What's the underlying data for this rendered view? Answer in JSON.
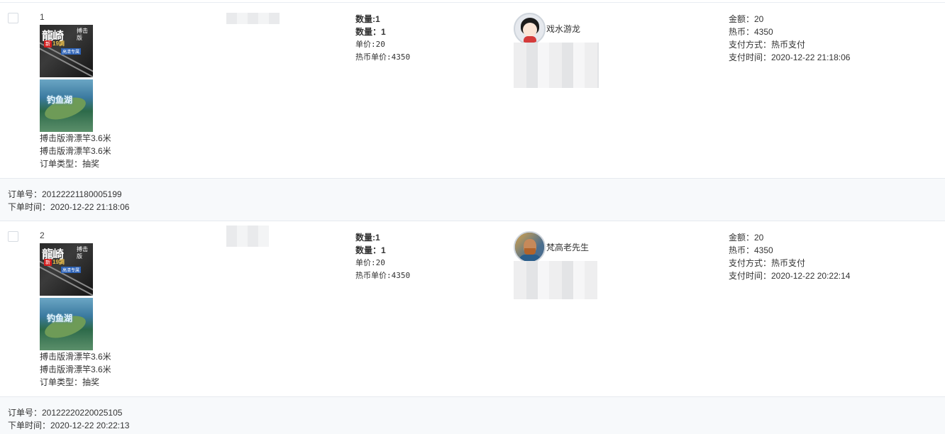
{
  "orders": [
    {
      "index": "1",
      "product_lines": [
        "搏击版滑漂竿3.6米",
        "搏击版滑漂竿3.6米",
        "订单类型：抽奖"
      ],
      "rod_image": {
        "title": "龍崎",
        "subtitle": "搏击版",
        "badge": "新",
        "gold": "19調",
        "blue": "高清专属"
      },
      "lake_image": {
        "text": "钓鱼湖"
      },
      "qty_lines": [
        "数量:1",
        "数量：1",
        "单价:20",
        "热币单价:4350"
      ],
      "nickname": "戏水游龙",
      "pay_lines": [
        "金额：20",
        "热币：4350",
        "支付方式：热币支付",
        "支付时间：2020-12-22 21:18:06"
      ],
      "order_no": "订单号：20122221180005199",
      "order_time": "下单时间：2020-12-22 21:18:06"
    },
    {
      "index": "2",
      "product_lines": [
        "搏击版滑漂竿3.6米",
        "搏击版滑漂竿3.6米",
        "订单类型：抽奖"
      ],
      "rod_image": {
        "title": "龍崎",
        "subtitle": "搏击版",
        "badge": "新",
        "gold": "19調",
        "blue": "高清专属"
      },
      "lake_image": {
        "text": "钓鱼湖"
      },
      "qty_lines": [
        "数量:1",
        "数量：1",
        "单价:20",
        "热币单价:4350"
      ],
      "nickname": "梵高老先生",
      "pay_lines": [
        "金额：20",
        "热币：4350",
        "支付方式：热币支付",
        "支付时间：2020-12-22 20:22:14"
      ],
      "order_no": "订单号：20122220220025105",
      "order_time": "下单时间：2020-12-22 20:22:13"
    }
  ],
  "colors": {
    "footer_bg": "#f7f9fb",
    "border": "#e6eaef",
    "text": "#333333"
  }
}
